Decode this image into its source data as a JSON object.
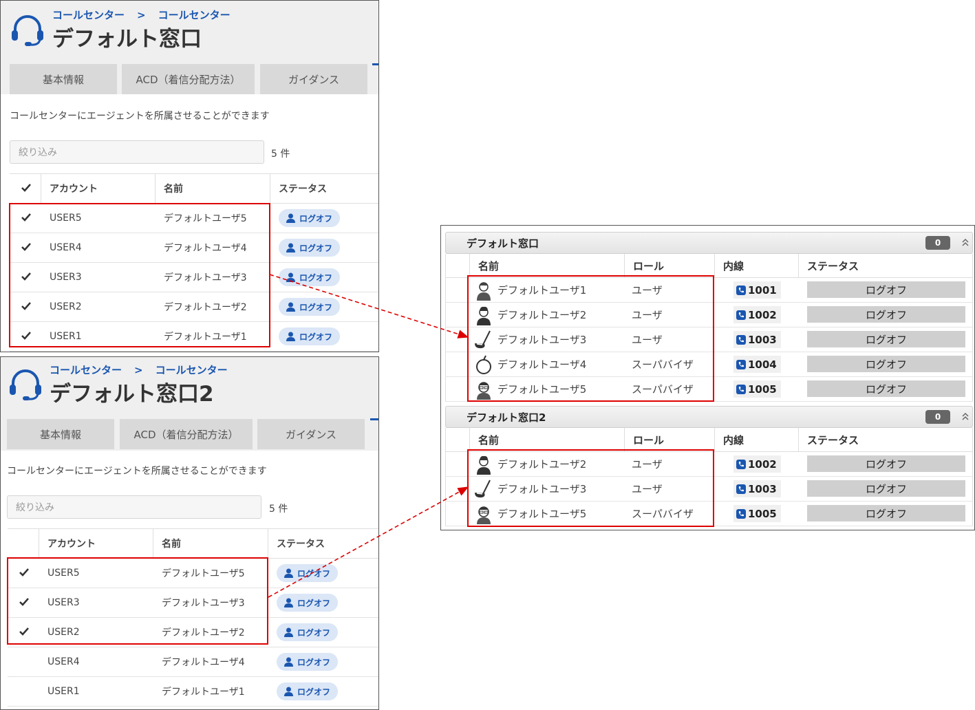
{
  "panel1": {
    "breadcrumb": [
      "コールセンター",
      ">",
      "コールセンター"
    ],
    "title": "デフォルト窓口",
    "tabs": [
      "基本情報",
      "ACD（着信分配方法）",
      "ガイダンス"
    ],
    "description": "コールセンターにエージェントを所属させることができます",
    "filter_placeholder": "絞り込み",
    "count": "5 件",
    "columns": [
      "アカウント",
      "名前",
      "ステータス"
    ],
    "rows": [
      {
        "account": "USER5",
        "name": "デフォルトユーザ5",
        "status": "ログオフ",
        "checked": true
      },
      {
        "account": "USER4",
        "name": "デフォルトユーザ4",
        "status": "ログオフ",
        "checked": true
      },
      {
        "account": "USER3",
        "name": "デフォルトユーザ3",
        "status": "ログオフ",
        "checked": true
      },
      {
        "account": "USER2",
        "name": "デフォルトユーザ2",
        "status": "ログオフ",
        "checked": true
      },
      {
        "account": "USER1",
        "name": "デフォルトユーザ1",
        "status": "ログオフ",
        "checked": true
      }
    ]
  },
  "panel2": {
    "breadcrumb": [
      "コールセンター",
      ">",
      "コールセンター"
    ],
    "title": "デフォルト窓口2",
    "tabs": [
      "基本情報",
      "ACD（着信分配方法）",
      "ガイダンス"
    ],
    "description": "コールセンターにエージェントを所属させることができます",
    "filter_placeholder": "絞り込み",
    "count": "5 件",
    "columns": [
      "アカウント",
      "名前",
      "ステータス"
    ],
    "rows": [
      {
        "account": "USER5",
        "name": "デフォルトユーザ5",
        "status": "ログオフ",
        "checked": true
      },
      {
        "account": "USER3",
        "name": "デフォルトユーザ3",
        "status": "ログオフ",
        "checked": true
      },
      {
        "account": "USER2",
        "name": "デフォルトユーザ2",
        "status": "ログオフ",
        "checked": true
      },
      {
        "account": "USER4",
        "name": "デフォルトユーザ4",
        "status": "ログオフ",
        "checked": false
      },
      {
        "account": "USER1",
        "name": "デフォルトユーザ1",
        "status": "ログオフ",
        "checked": false
      }
    ]
  },
  "monitor": {
    "columns": [
      "名前",
      "ロール",
      "内線",
      "ステータス"
    ],
    "groups": [
      {
        "title": "デフォルト窓口",
        "badge": "0",
        "rows": [
          {
            "avatar": "woman-avatar-icon",
            "name": "デフォルトユーザ1",
            "role": "ユーザ",
            "ext": "1001",
            "status": "ログオフ"
          },
          {
            "avatar": "man-avatar-icon",
            "name": "デフォルトユーザ2",
            "role": "ユーザ",
            "ext": "1002",
            "status": "ログオフ"
          },
          {
            "avatar": "golf-club-icon",
            "name": "デフォルトユーザ3",
            "role": "ユーザ",
            "ext": "1003",
            "status": "ログオフ"
          },
          {
            "avatar": "apple-icon",
            "name": "デフォルトユーザ4",
            "role": "スーパバイザ",
            "ext": "1004",
            "status": "ログオフ"
          },
          {
            "avatar": "glasses-man-avatar-icon",
            "name": "デフォルトユーザ5",
            "role": "スーパバイザ",
            "ext": "1005",
            "status": "ログオフ"
          }
        ]
      },
      {
        "title": "デフォルト窓口2",
        "badge": "0",
        "rows": [
          {
            "avatar": "man-avatar-icon",
            "name": "デフォルトユーザ2",
            "role": "ユーザ",
            "ext": "1002",
            "status": "ログオフ"
          },
          {
            "avatar": "golf-club-icon",
            "name": "デフォルトユーザ3",
            "role": "ユーザ",
            "ext": "1003",
            "status": "ログオフ"
          },
          {
            "avatar": "glasses-man-avatar-icon",
            "name": "デフォルトユーザ5",
            "role": "スーパバイザ",
            "ext": "1005",
            "status": "ログオフ"
          }
        ]
      }
    ]
  },
  "colors": {
    "accent": "#1a56b0",
    "highlight": "#dd0000",
    "pill_bg": "#dbe6f6",
    "status_bg": "#cfcfcf"
  }
}
